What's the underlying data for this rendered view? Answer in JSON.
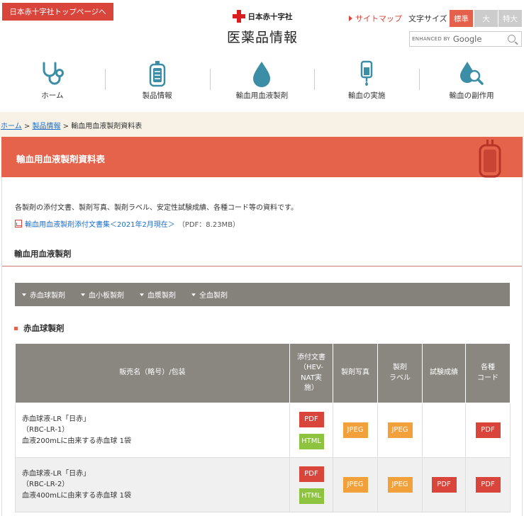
{
  "header": {
    "top_link": "日本赤十字社トップページへ",
    "org": "日本赤十字社",
    "title": "医薬品情報",
    "sitemap": "サイトマップ",
    "font_size_label": "文字サイズ",
    "font_sizes": [
      "標準",
      "大",
      "特大"
    ],
    "search_brand": "ENHANCED BY",
    "search_google": "Google"
  },
  "nav": [
    {
      "label": "ホーム",
      "icon": "stethoscope-icon"
    },
    {
      "label": "製品情報",
      "icon": "blood-bag-icon"
    },
    {
      "label": "輸血用血液製剤",
      "icon": "blood-drop-icon"
    },
    {
      "label": "輸血の実施",
      "icon": "iv-drip-icon"
    },
    {
      "label": "輸血の副作用",
      "icon": "magnifier-drop-icon"
    }
  ],
  "breadcrumb": {
    "home": "ホーム",
    "sep1": " > ",
    "products": "製品情報",
    "sep2": " > ",
    "current": "輸血用血液製剤資料表"
  },
  "banner_title": "輸血用血液製剤資料表",
  "intro": "各製剤の添付文書、製剤写真、製剤ラベル、安定性試験成績、各種コード等の資料です。",
  "pdf_link": {
    "text": "輸血用血液製剤添付文書集＜2021年2月現在＞",
    "meta": "（PDF：8.23MB）"
  },
  "section_title": "輸血用血液製剤",
  "tabs": [
    "赤血球製剤",
    "血小板製剤",
    "血漿製剤",
    "全血製剤"
  ],
  "sub_title": "赤血球製剤",
  "table": {
    "headers": {
      "name": "販売名（略号）/包装",
      "doc_line1": "添付文書",
      "doc_line2": "（HEV-",
      "doc_line3": "NAT実",
      "doc_line4": "施）",
      "photo": "製剤写真",
      "label_line1": "製剤",
      "label_line2": "ラベル",
      "test": "試験成績",
      "code_line1": "各種",
      "code_line2": "コード"
    },
    "rows": [
      {
        "name1": "赤血球液-LR「日赤」",
        "name2": "（RBC-LR-1）",
        "name3": "血液200mLに由来する赤血球 1袋",
        "doc_pdf": "PDF",
        "doc_html": "HTML",
        "photo": "JPEG",
        "label": "JPEG",
        "test": "",
        "code": "PDF"
      },
      {
        "name1": "赤血球液-LR「日赤」",
        "name2": "（RBC-LR-2）",
        "name3": "血液400mLに由来する赤血球 1袋",
        "doc_pdf": "PDF",
        "doc_html": "HTML",
        "photo": "JPEG",
        "label": "JPEG",
        "test": "PDF",
        "code": "PDF"
      }
    ]
  },
  "colors": {
    "accent": "#e4634a",
    "red": "#d9453b",
    "teal": "#3b8ea5",
    "html_green": "#8dc33f",
    "jpeg_orange": "#f1a03a"
  }
}
